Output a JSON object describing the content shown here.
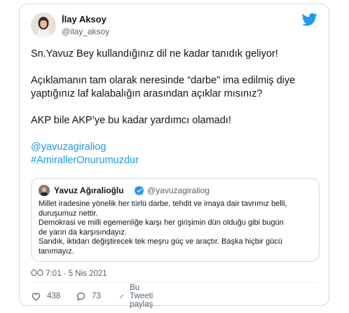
{
  "tweet": {
    "author": {
      "name": "İlay Aksoy",
      "handle": "@ilay_aksoy",
      "avatar_icon": "profile-photo"
    },
    "brand_icon": "twitter-bird-icon",
    "brand_color": "#1d9bf0",
    "paragraphs": [
      "Sn.Yavuz Bey kullandığınız dil ne kadar tanıdık geliyor!",
      "Açıklamanın tam olarak neresinde “darbe” ima edilmiş diye",
      "yaptığınız laf kalabalığın arasından açıklar mısınız?",
      "AKP bile AKP’ye bu kadar yardımcı olamadı!"
    ],
    "mention": "@yavuzagiraliog",
    "hashtag": "#AmirallerOnurumuzdur",
    "timestamp": "ÖÖ 7:01 · 5 Nis 2021"
  },
  "quoted_tweet": {
    "name": "Yavuz Ağıralioğlu",
    "handle": "@yavuzagiraliog",
    "verified": true,
    "lines": [
      "Millet iradesine yönelik her türlü darbe, tehdit ve imaya dair tavrımız belli,",
      "duruşumuz nettir.",
      "Demokrasi ve milli egemenliğe karşı her girişimin dün olduğu gibi bugün",
      "de yarın da karşısındayız.",
      "Sandık, iktidarı değiştirecek tek meşru güç ve araçtır. Başka hiçbir gücü",
      "tanımayız."
    ]
  },
  "actions": {
    "likes": "438",
    "replies": "73",
    "share_label": "Bu Tweeti paylaş"
  }
}
